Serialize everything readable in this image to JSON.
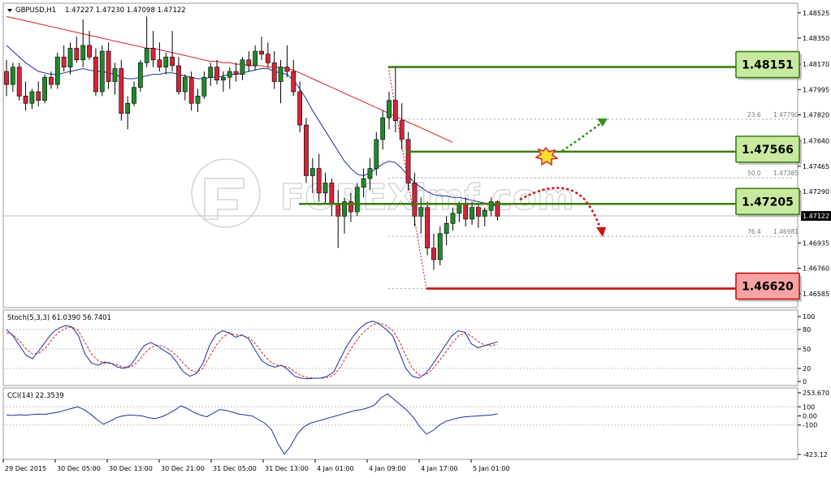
{
  "header": {
    "symbol": "GBPUSD,H1",
    "ohlc": "1.47227 1.47230 1.47098 1.47122"
  },
  "watermark": "FOREXimf.com",
  "colors": {
    "bull": "#1f8a2a",
    "bear": "#d4243a",
    "ma_fast": "#1a2f9c",
    "ma_slow": "#d62020",
    "level_green": "#3b7d12",
    "level_red": "#cc1111",
    "box_green": "#c8eaa0",
    "box_red": "#f7a3a3",
    "stoch_main": "#1a2f9c",
    "stoch_signal": "#d62020"
  },
  "chart_data": [
    {
      "type": "candlestick",
      "title": "GBPUSD,H1",
      "ylim": [
        1.465,
        1.4858
      ],
      "y_ticks": [
        "1.48525",
        "1.48350",
        "1.48170",
        "1.47995",
        "1.47820",
        "1.47640",
        "1.47465",
        "1.47290",
        "1.46935",
        "1.46760",
        "1.46585"
      ],
      "current_price": "1.47122",
      "x_labels": [
        "29 Dec 2015",
        "30 Dec 05:00",
        "30 Dec 13:00",
        "30 Dec 21:00",
        "31 Dec 05:00",
        "31 Dec 13:00",
        "4 Jan 01:00",
        "4 Jan 09:00",
        "4 Jan 17:00",
        "5 Jan 01:00"
      ],
      "candles": [
        [
          1.4812,
          1.482,
          1.4795,
          1.4803
        ],
        [
          1.4803,
          1.4818,
          1.4798,
          1.4815
        ],
        [
          1.4815,
          1.4818,
          1.4792,
          1.4795
        ],
        [
          1.4795,
          1.4805,
          1.4785,
          1.479
        ],
        [
          1.479,
          1.48,
          1.4786,
          1.4798
        ],
        [
          1.4798,
          1.4805,
          1.4788,
          1.4792
        ],
        [
          1.4792,
          1.481,
          1.479,
          1.4808
        ],
        [
          1.4808,
          1.4812,
          1.48,
          1.4803
        ],
        [
          1.4803,
          1.4825,
          1.48,
          1.4822
        ],
        [
          1.4822,
          1.483,
          1.4812,
          1.4815
        ],
        [
          1.4815,
          1.4832,
          1.481,
          1.4828
        ],
        [
          1.4828,
          1.4836,
          1.4818,
          1.482
        ],
        [
          1.482,
          1.4848,
          1.4815,
          1.483
        ],
        [
          1.483,
          1.484,
          1.482,
          1.4822
        ],
        [
          1.4822,
          1.4828,
          1.4795,
          1.4798
        ],
        [
          1.4798,
          1.483,
          1.4795,
          1.4826
        ],
        [
          1.4826,
          1.4832,
          1.48,
          1.4805
        ],
        [
          1.4805,
          1.4818,
          1.4796,
          1.4814
        ],
        [
          1.4814,
          1.482,
          1.4778,
          1.4783
        ],
        [
          1.4783,
          1.4795,
          1.4772,
          1.479
        ],
        [
          1.479,
          1.4805,
          1.4788,
          1.4801
        ],
        [
          1.4801,
          1.482,
          1.4798,
          1.4818
        ],
        [
          1.4818,
          1.485,
          1.4815,
          1.4828
        ],
        [
          1.4828,
          1.484,
          1.4815,
          1.482
        ],
        [
          1.482,
          1.4832,
          1.4812,
          1.4815
        ],
        [
          1.4815,
          1.4825,
          1.481,
          1.4822
        ],
        [
          1.4822,
          1.484,
          1.4812,
          1.4816
        ],
        [
          1.4816,
          1.4822,
          1.4796,
          1.4798
        ],
        [
          1.4798,
          1.481,
          1.4792,
          1.4808
        ],
        [
          1.4808,
          1.4812,
          1.4785,
          1.479
        ],
        [
          1.479,
          1.48,
          1.4784,
          1.4795
        ],
        [
          1.4795,
          1.4812,
          1.4793,
          1.4808
        ],
        [
          1.4808,
          1.4818,
          1.4802,
          1.4815
        ],
        [
          1.4815,
          1.482,
          1.4803,
          1.4806
        ],
        [
          1.4806,
          1.4812,
          1.4798,
          1.4808
        ],
        [
          1.4808,
          1.4815,
          1.48,
          1.4812
        ],
        [
          1.4812,
          1.4818,
          1.4805,
          1.481
        ],
        [
          1.481,
          1.4822,
          1.4806,
          1.482
        ],
        [
          1.482,
          1.4826,
          1.4812,
          1.4816
        ],
        [
          1.4816,
          1.483,
          1.4813,
          1.4826
        ],
        [
          1.4826,
          1.4836,
          1.482,
          1.4824
        ],
        [
          1.4824,
          1.4832,
          1.4815,
          1.4818
        ],
        [
          1.4818,
          1.4826,
          1.48,
          1.4805
        ],
        [
          1.4805,
          1.482,
          1.479,
          1.4815
        ],
        [
          1.4815,
          1.483,
          1.4808,
          1.4812
        ],
        [
          1.4812,
          1.482,
          1.4795,
          1.4798
        ],
        [
          1.4798,
          1.4805,
          1.477,
          1.4775
        ],
        [
          1.4775,
          1.478,
          1.4735,
          1.474
        ],
        [
          1.474,
          1.4752,
          1.4728,
          1.4745
        ],
        [
          1.4745,
          1.4755,
          1.4722,
          1.4728
        ],
        [
          1.4728,
          1.4742,
          1.472,
          1.4735
        ],
        [
          1.4735,
          1.4738,
          1.4712,
          1.472
        ],
        [
          1.472,
          1.473,
          1.469,
          1.4712
        ],
        [
          1.4712,
          1.4725,
          1.47,
          1.4722
        ],
        [
          1.4722,
          1.4728,
          1.4708,
          1.4715
        ],
        [
          1.4715,
          1.4735,
          1.4712,
          1.4732
        ],
        [
          1.4732,
          1.4745,
          1.4725,
          1.4738
        ],
        [
          1.4738,
          1.4752,
          1.473,
          1.4745
        ],
        [
          1.4745,
          1.477,
          1.474,
          1.4765
        ],
        [
          1.4765,
          1.4785,
          1.4758,
          1.478
        ],
        [
          1.478,
          1.4798,
          1.4772,
          1.4792
        ],
        [
          1.4792,
          1.4815,
          1.477,
          1.4778
        ],
        [
          1.4778,
          1.479,
          1.4758,
          1.4765
        ],
        [
          1.4765,
          1.477,
          1.473,
          1.4735
        ],
        [
          1.4735,
          1.4742,
          1.4705,
          1.4712
        ],
        [
          1.4712,
          1.4725,
          1.47,
          1.4718
        ],
        [
          1.4718,
          1.4722,
          1.4685,
          1.469
        ],
        [
          1.469,
          1.47,
          1.4675,
          1.4682
        ],
        [
          1.4682,
          1.4705,
          1.4678,
          1.47
        ],
        [
          1.47,
          1.4712,
          1.4692,
          1.4707
        ],
        [
          1.4707,
          1.4718,
          1.4702,
          1.4714
        ],
        [
          1.4714,
          1.4722,
          1.4708,
          1.472
        ],
        [
          1.472,
          1.4725,
          1.4705,
          1.471
        ],
        [
          1.471,
          1.4722,
          1.4706,
          1.4718
        ],
        [
          1.4718,
          1.472,
          1.4704,
          1.4712
        ],
        [
          1.4712,
          1.4718,
          1.4705,
          1.4716
        ],
        [
          1.4716,
          1.4725,
          1.4712,
          1.4722
        ],
        [
          1.4722,
          1.4723,
          1.4709,
          1.4712
        ]
      ],
      "ma_fast": [
        1.483,
        1.4826,
        1.4822,
        1.4818,
        1.4815,
        1.4812,
        1.4811,
        1.481,
        1.481,
        1.4811,
        1.4812,
        1.4813,
        1.4814,
        1.4813,
        1.4812,
        1.4812,
        1.4811,
        1.481,
        1.4808,
        1.4807,
        1.4807,
        1.4808,
        1.4809,
        1.481,
        1.481,
        1.4811,
        1.4811,
        1.481,
        1.4809,
        1.4808,
        1.4807,
        1.4807,
        1.4808,
        1.4808,
        1.4809,
        1.481,
        1.481,
        1.4811,
        1.4812,
        1.4813,
        1.4814,
        1.4814,
        1.4812,
        1.4811,
        1.481,
        1.4806,
        1.48,
        1.4793,
        1.4785,
        1.4778,
        1.4771,
        1.4764,
        1.4757,
        1.475,
        1.4745,
        1.4741,
        1.474,
        1.4742,
        1.4745,
        1.4748,
        1.475,
        1.4749,
        1.4745,
        1.474,
        1.4735,
        1.4732,
        1.4729,
        1.4727,
        1.4726,
        1.4726,
        1.4725,
        1.4725,
        1.4724,
        1.4723,
        1.4722,
        1.4721,
        1.472,
        1.4719
      ],
      "ma_slow": [
        1.485,
        1.4849,
        1.4848,
        1.4847,
        1.4846,
        1.4845,
        1.4844,
        1.4843,
        1.4842,
        1.4841,
        1.484,
        1.4839,
        1.4838,
        1.4837,
        1.4836,
        1.4835,
        1.4834,
        1.4833,
        1.4832,
        1.4831,
        1.483,
        1.4829,
        1.4828,
        1.4828,
        1.4827,
        1.4826,
        1.4825,
        1.4824,
        1.4823,
        1.4822,
        1.4821,
        1.482,
        1.4819,
        1.4819,
        1.4818,
        1.4818,
        1.4817,
        1.4817,
        1.4816,
        1.4816,
        1.4816,
        1.4815,
        1.4815,
        1.4815,
        1.4814,
        1.4813,
        1.4811,
        1.4809,
        1.4807,
        1.4805,
        1.4803,
        1.4801,
        1.4799,
        1.4797,
        1.4795,
        1.4793,
        1.4791,
        1.4789,
        1.4787,
        1.4785,
        1.4783,
        1.4781,
        1.4779,
        1.4777,
        1.4775,
        1.4773,
        1.4771,
        1.4769,
        1.4767,
        1.4765,
        1.4763
      ],
      "levels": [
        {
          "value": 1.48151,
          "label": "1.48151",
          "kind": "resistance"
        },
        {
          "value": 1.47566,
          "label": "1.47566",
          "kind": "resistance"
        },
        {
          "value": 1.47205,
          "label": "1.47205",
          "kind": "pivot"
        },
        {
          "value": 1.4662,
          "label": "1.46620",
          "kind": "support"
        }
      ],
      "fibonacci": [
        {
          "ratio": "23.6",
          "price": "1.47790",
          "value": 1.4779
        },
        {
          "ratio": "50.0",
          "price": "1.47385",
          "value": 1.47385
        },
        {
          "ratio": "76.4",
          "price": "1.46981",
          "value": 1.46981
        }
      ]
    },
    {
      "type": "line",
      "title": "Stoch(5,3,3) 61.0390 56.7401",
      "ylim": [
        0,
        100
      ],
      "y_ticks": [
        "100",
        "80",
        "50",
        "20",
        "0"
      ],
      "series": [
        {
          "values": [
            80,
            70,
            55,
            40,
            35,
            48,
            62,
            75,
            82,
            86,
            84,
            70,
            42,
            28,
            25,
            30,
            28,
            22,
            20,
            25,
            40,
            55,
            60,
            55,
            48,
            42,
            30,
            15,
            8,
            12,
            28,
            55,
            72,
            78,
            75,
            68,
            72,
            65,
            48,
            32,
            25,
            22,
            25,
            18,
            8,
            5,
            4,
            5,
            5,
            8,
            15,
            35,
            55,
            70,
            82,
            90,
            93,
            88,
            80,
            70,
            45,
            20,
            8,
            5,
            12,
            25,
            40,
            55,
            70,
            78,
            76,
            58,
            52,
            55,
            58,
            61
          ]
        },
        {
          "values": [
            75,
            72,
            62,
            50,
            42,
            44,
            52,
            65,
            76,
            82,
            84,
            78,
            60,
            42,
            32,
            28,
            28,
            25,
            22,
            22,
            30,
            42,
            52,
            56,
            54,
            48,
            40,
            28,
            18,
            14,
            20,
            38,
            55,
            68,
            74,
            72,
            70,
            68,
            58,
            45,
            33,
            26,
            24,
            22,
            15,
            9,
            6,
            5,
            5,
            6,
            10,
            22,
            40,
            56,
            70,
            80,
            88,
            90,
            86,
            78,
            62,
            40,
            20,
            10,
            10,
            18,
            30,
            44,
            58,
            70,
            75,
            70,
            62,
            56,
            55,
            57
          ]
        }
      ]
    },
    {
      "type": "line",
      "title": "CCI(14) 22.3539",
      "ylim": [
        -423.12,
        253.67
      ],
      "y_ticks": [
        "253.670",
        "100",
        "0.00",
        "-100",
        "-423.12"
      ],
      "series": [
        {
          "values": [
            10,
            5,
            12,
            8,
            15,
            20,
            18,
            30,
            40,
            60,
            80,
            100,
            70,
            20,
            -40,
            -90,
            -60,
            -20,
            0,
            10,
            5,
            0,
            -20,
            -30,
            -10,
            20,
            60,
            110,
            80,
            40,
            10,
            -10,
            30,
            70,
            60,
            40,
            20,
            10,
            0,
            -40,
            -80,
            -150,
            -300,
            -420,
            -330,
            -200,
            -120,
            -80,
            -60,
            -40,
            -20,
            0,
            20,
            40,
            60,
            70,
            90,
            120,
            200,
            240,
            180,
            120,
            60,
            -20,
            -120,
            -200,
            -160,
            -100,
            -60,
            -40,
            -20,
            -10,
            -5,
            0,
            5,
            10,
            22
          ]
        }
      ]
    }
  ]
}
